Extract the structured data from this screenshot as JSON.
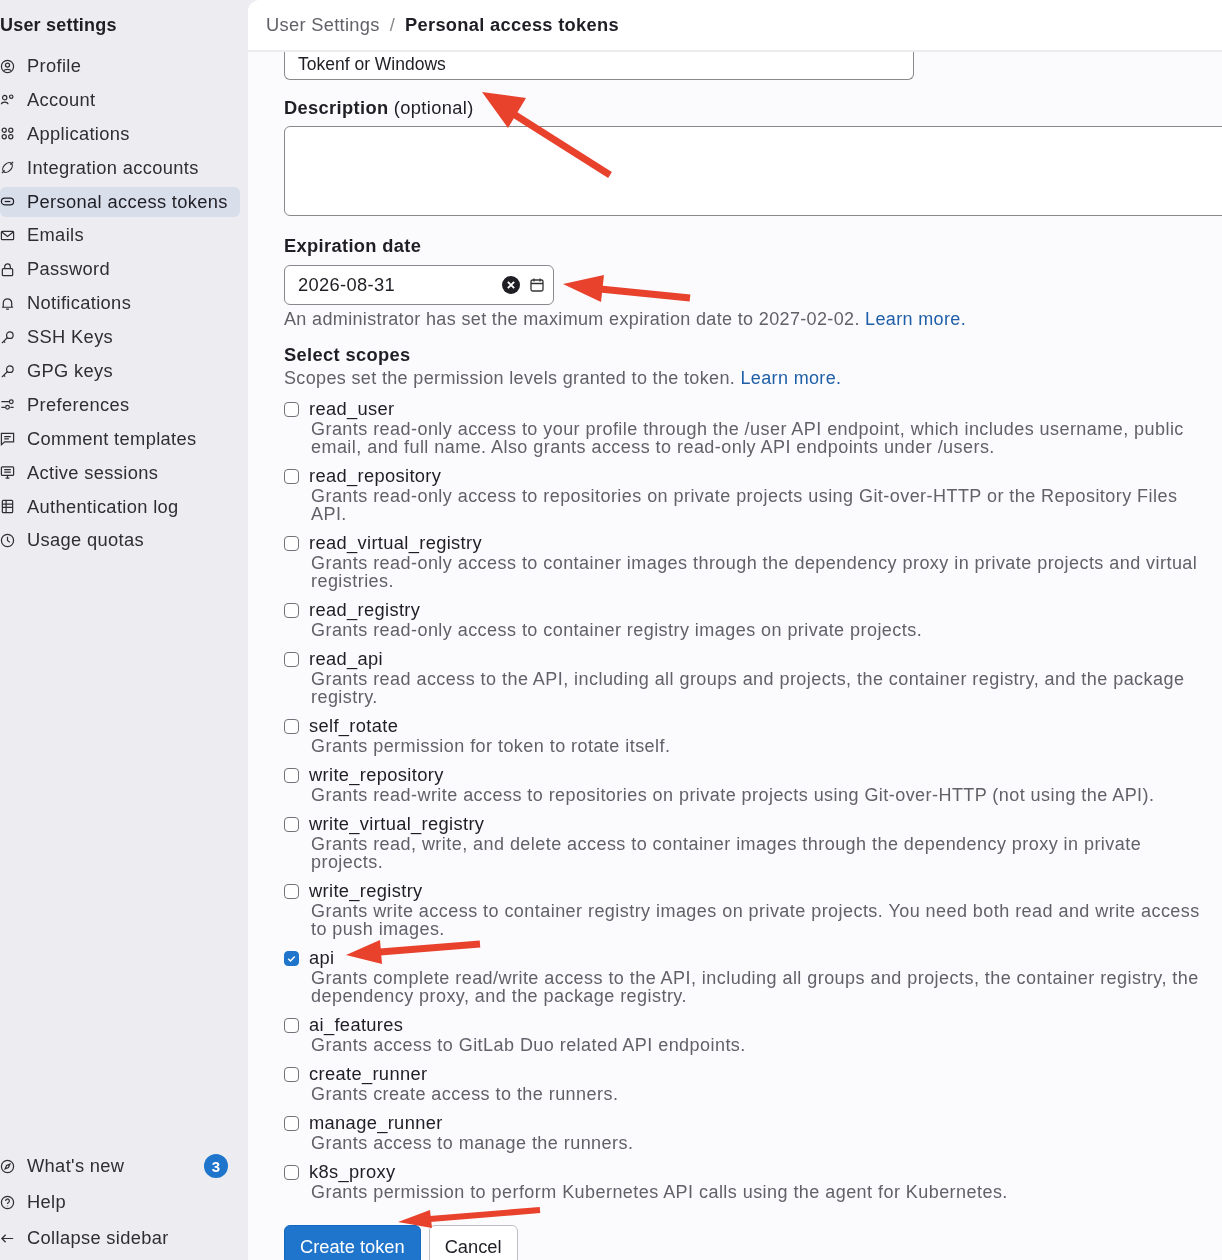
{
  "sidebar": {
    "title": "User settings",
    "items": [
      {
        "label": "Profile",
        "selected": false
      },
      {
        "label": "Account",
        "selected": false
      },
      {
        "label": "Applications",
        "selected": false
      },
      {
        "label": "Integration accounts",
        "selected": false
      },
      {
        "label": "Personal access tokens",
        "selected": true
      },
      {
        "label": "Emails",
        "selected": false
      },
      {
        "label": "Password",
        "selected": false
      },
      {
        "label": "Notifications",
        "selected": false
      },
      {
        "label": "SSH Keys",
        "selected": false
      },
      {
        "label": "GPG keys",
        "selected": false
      },
      {
        "label": "Preferences",
        "selected": false
      },
      {
        "label": "Comment templates",
        "selected": false
      },
      {
        "label": "Active sessions",
        "selected": false
      },
      {
        "label": "Authentication log",
        "selected": false
      },
      {
        "label": "Usage quotas",
        "selected": false
      }
    ],
    "footer": [
      {
        "label": "What's new",
        "badge": "3"
      },
      {
        "label": "Help"
      },
      {
        "label": "Collapse sidebar"
      }
    ]
  },
  "breadcrumb": {
    "items": [
      "User Settings",
      "Personal access tokens"
    ],
    "separator": "/"
  },
  "form": {
    "token_name": "Tokenf or Windows",
    "description_label": "Description",
    "description_hint": "(optional)",
    "expiration_label": "Expiration date",
    "expiration_value": "2026-08-31",
    "expiration_help": "An administrator has set the maximum expiration date to 2027-02-02.",
    "expiration_link": "Learn more.",
    "scopes_label": "Select scopes",
    "scopes_help": "Scopes set the permission levels granted to the token.",
    "scopes_link": "Learn more.",
    "scopes": [
      {
        "name": "read_user",
        "checked": false,
        "description": "Grants read-only access to your profile through the /user API endpoint, which includes username, public email, and full name. Also grants access to read-only API endpoints under /users."
      },
      {
        "name": "read_repository",
        "checked": false,
        "description": "Grants read-only access to repositories on private projects using Git-over-HTTP or the Repository Files API."
      },
      {
        "name": "read_virtual_registry",
        "checked": false,
        "description": "Grants read-only access to container images through the dependency proxy in private projects and virtual registries."
      },
      {
        "name": "read_registry",
        "checked": false,
        "description": "Grants read-only access to container registry images on private projects."
      },
      {
        "name": "read_api",
        "checked": false,
        "description": "Grants read access to the API, including all groups and projects, the container registry, and the package registry."
      },
      {
        "name": "self_rotate",
        "checked": false,
        "description": "Grants permission for token to rotate itself."
      },
      {
        "name": "write_repository",
        "checked": false,
        "description": "Grants read-write access to repositories on private projects using Git-over-HTTP (not using the API)."
      },
      {
        "name": "write_virtual_registry",
        "checked": false,
        "description": "Grants read, write, and delete access to container images through the dependency proxy in private projects."
      },
      {
        "name": "write_registry",
        "checked": false,
        "description": "Grants write access to container registry images on private projects. You need both read and write access to push images."
      },
      {
        "name": "api",
        "checked": true,
        "description": "Grants complete read/write access to the API, including all groups and projects, the container registry, the dependency proxy, and the package registry."
      },
      {
        "name": "ai_features",
        "checked": false,
        "description": "Grants access to GitLab Duo related API endpoints."
      },
      {
        "name": "create_runner",
        "checked": false,
        "description": "Grants create access to the runners."
      },
      {
        "name": "manage_runner",
        "checked": false,
        "description": "Grants access to manage the runners."
      },
      {
        "name": "k8s_proxy",
        "checked": false,
        "description": "Grants permission to perform Kubernetes API calls using the agent for Kubernetes."
      }
    ],
    "buttons": [
      {
        "label": "Create token",
        "kind": "primary"
      },
      {
        "label": "Cancel",
        "kind": "secondary"
      }
    ]
  }
}
